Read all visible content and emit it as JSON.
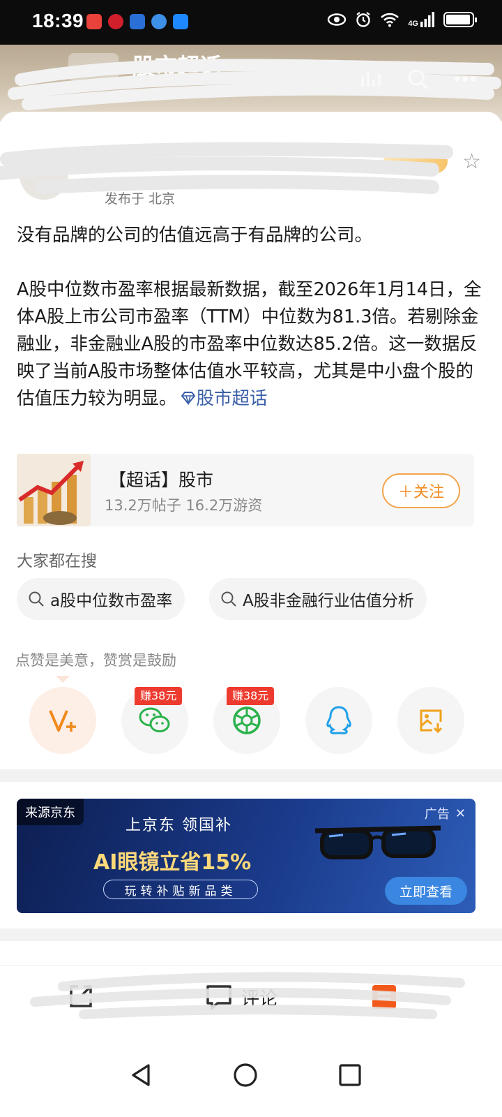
{
  "status_bar": {
    "time": "18:39",
    "network": "4G"
  },
  "header": {
    "title": "股市超话"
  },
  "post": {
    "location": "发布于 北京",
    "paragraph1": "没有品牌的公司的估值远高于有品牌的公司。",
    "paragraph2": "A股中位数市盈率根据最新数据，截至2026年1月14日，全体A股上市公司市盈率（TTM）中位数为81.3倍。若剔除金融业，非金融业A股的市盈率中位数达85.2倍。这一数据反映了当前A股市场整体估值水平较高，尤其是中小盘个股的估值压力较为明显。",
    "topic_link": "股市超话"
  },
  "chaohua_card": {
    "name": "【超话】股市",
    "stats": "13.2万帖子 16.2万游资",
    "follow_label": "＋关注"
  },
  "search_section": {
    "label": "大家都在搜",
    "chips": [
      "a股中位数市盈率",
      "A股非金融行业估值分析"
    ]
  },
  "share_section": {
    "label": "点赞是美意，赞赏是鼓励",
    "earn_wechat": "赚38元",
    "earn_moments": "赚38元"
  },
  "ad": {
    "source": "来源京东",
    "tag": "广告",
    "line1": "上京东 领国补",
    "line2": "AI眼镜立省15%",
    "line3": "玩转补贴新品类",
    "cta": "立即查看"
  },
  "action_bar": {
    "comment_label": "评论"
  },
  "colors": {
    "accent_orange": "#f08a1c",
    "link_blue": "#3a5fa8",
    "earn_red": "#ee3b2f"
  }
}
